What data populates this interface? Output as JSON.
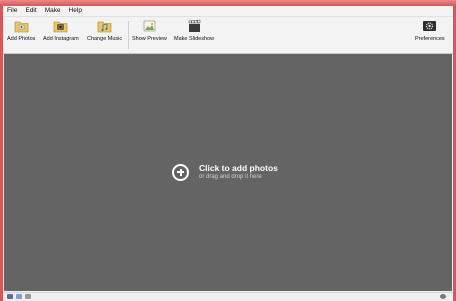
{
  "menu": [
    "File",
    "Edit",
    "Make",
    "Help"
  ],
  "toolbar": {
    "add_photos": "Add Photos",
    "add_instagram": "Add Instagram",
    "change_music": "Change Music",
    "show_preview": "Show Preview",
    "make_slideshow": "Make Slideshow",
    "preferences": "Preferences"
  },
  "canvas": {
    "title": "Click to add photos",
    "subtitle": "or drag and drop it here"
  },
  "icons": {
    "add_photos": "folder-photo-icon",
    "add_instagram": "instagram-camera-icon",
    "change_music": "music-note-icon",
    "show_preview": "preview-picture-icon",
    "make_slideshow": "clapperboard-icon",
    "preferences": "gear-icon"
  },
  "colors": {
    "canvas_bg": "#646464",
    "window_frame": "#d8585a"
  }
}
